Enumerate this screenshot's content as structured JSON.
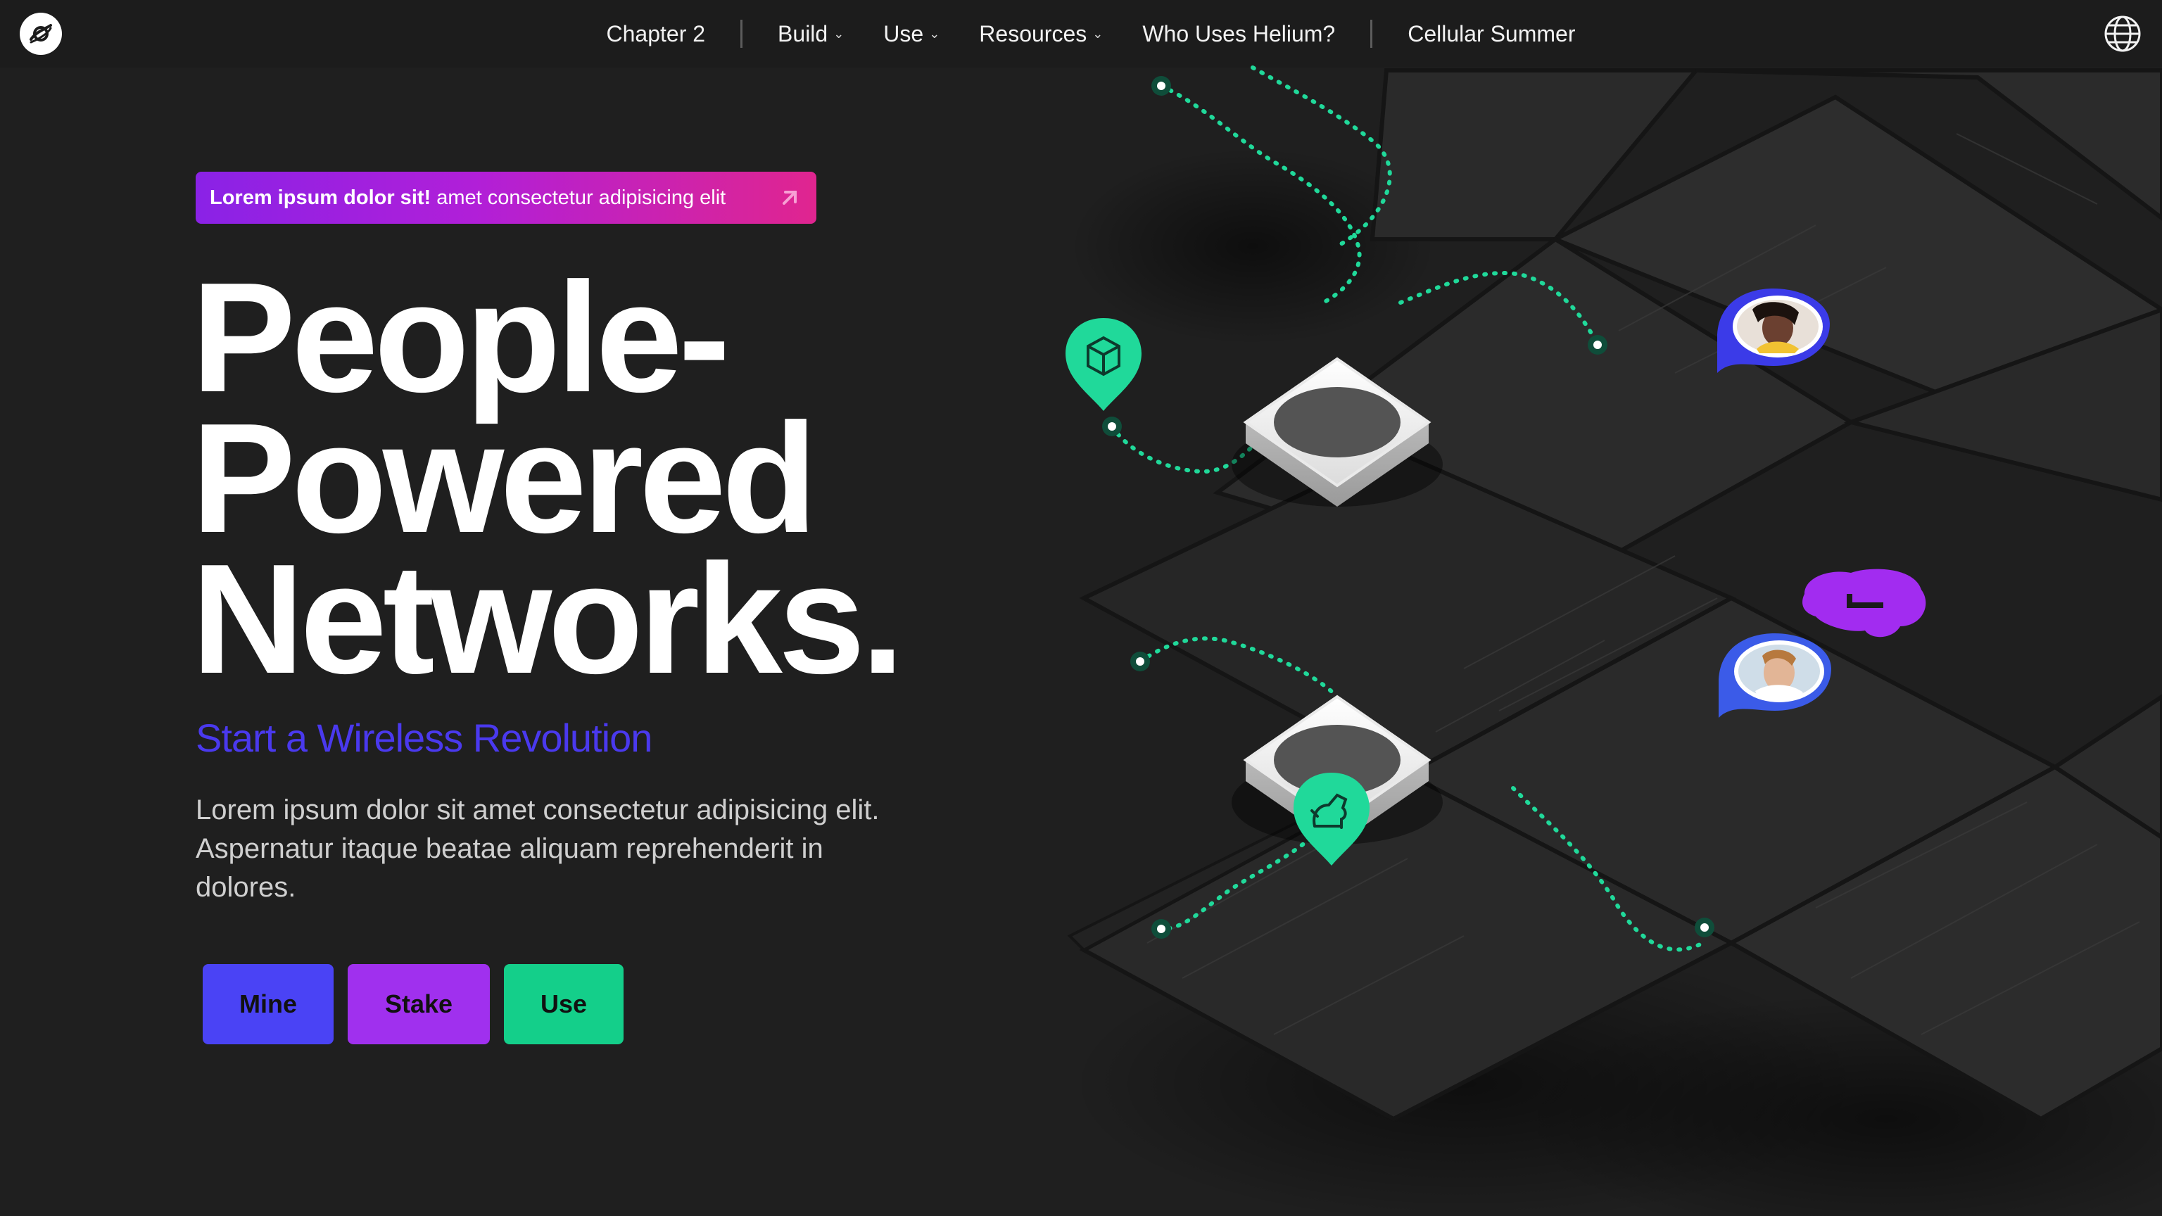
{
  "nav": {
    "items": [
      {
        "label": "Chapter 2",
        "dropdown": false
      },
      {
        "label": "Build",
        "dropdown": true
      },
      {
        "label": "Use",
        "dropdown": true
      },
      {
        "label": "Resources",
        "dropdown": true
      },
      {
        "label": "Who Uses Helium?",
        "dropdown": false
      },
      {
        "label": "Cellular Summer",
        "dropdown": false
      }
    ],
    "logo_icon": "helium-logo-icon",
    "language_icon": "globe-icon",
    "chevron": "⌄"
  },
  "banner": {
    "bold": "Lorem ipsum dolor sit!",
    "text": "amet consectetur adipisicing elit",
    "icon": "arrow-up-right-icon"
  },
  "hero": {
    "line1": "People-",
    "line2": "Powered",
    "line3": "Networks.",
    "subtitle": "Start a Wireless Revolution",
    "description": "Lorem ipsum dolor sit amet consectetur adipisicing elit. Aspernatur itaque beatae aliquam reprehenderit in dolores."
  },
  "buttons": {
    "mine": "Mine",
    "stake": "Stake",
    "use": "Use"
  },
  "colors": {
    "background": "#1f1f1f",
    "mine": "#4a43f5",
    "stake": "#a030ee",
    "use": "#14cf8a",
    "subtitle": "#4a39ee",
    "route": "#20d99a"
  }
}
